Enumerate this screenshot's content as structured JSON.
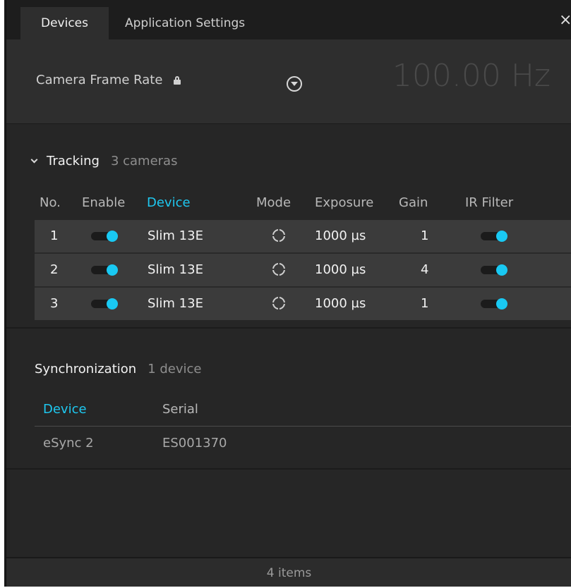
{
  "tabs": [
    {
      "label": "Devices",
      "active": true
    },
    {
      "label": "Application Settings",
      "active": false
    }
  ],
  "close_glyph": "×",
  "frame_rate": {
    "label": "Camera Frame Rate",
    "value": "100.00 Hz",
    "locked": true
  },
  "tracking": {
    "title": "Tracking",
    "count": "3 cameras",
    "columns": [
      "No.",
      "Enable",
      "Device",
      "Mode",
      "Exposure",
      "Gain",
      "IR Filter"
    ],
    "rows": [
      {
        "no": "1",
        "enabled": true,
        "device": "Slim 13E",
        "mode": "crosshair-icon",
        "exposure": "1000 µs",
        "gain": "1",
        "ir_filter": true
      },
      {
        "no": "2",
        "enabled": true,
        "device": "Slim 13E",
        "mode": "crosshair-icon",
        "exposure": "1000 µs",
        "gain": "4",
        "ir_filter": true
      },
      {
        "no": "3",
        "enabled": true,
        "device": "Slim 13E",
        "mode": "crosshair-icon",
        "exposure": "1000 µs",
        "gain": "1",
        "ir_filter": true
      }
    ]
  },
  "synchronization": {
    "title": "Synchronization",
    "count": "1 device",
    "columns": [
      "Device",
      "Serial"
    ],
    "rows": [
      {
        "device": "eSync 2",
        "serial": "ES001370"
      }
    ]
  },
  "status": {
    "text": "4 items"
  },
  "colors": {
    "accent": "#1ec8f0",
    "background": "#262626",
    "row": "#3b3b3b"
  }
}
